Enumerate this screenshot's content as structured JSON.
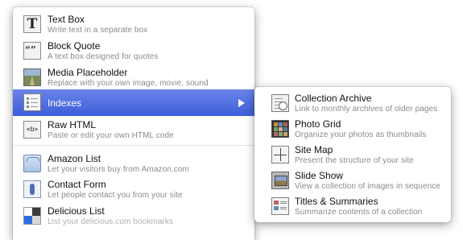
{
  "main_menu": {
    "items": [
      {
        "title": "Text Box",
        "subtitle": "Write text in a separate box",
        "icon": "text-box-icon"
      },
      {
        "title": "Block Quote",
        "subtitle": "A text box designed for quotes",
        "icon": "block-quote-icon"
      },
      {
        "title": "Media Placeholder",
        "subtitle": "Replace with your own image, movie, sound",
        "icon": "media-placeholder-icon"
      },
      {
        "title": "Indexes",
        "icon": "indexes-icon",
        "selected": true
      },
      {
        "title": "Raw HTML",
        "subtitle": "Paste or edit your own HTML code",
        "icon": "html-icon"
      },
      {
        "title": "Amazon List",
        "subtitle": "Let your visitors buy from Amazon.com",
        "icon": "amazon-list-icon"
      },
      {
        "title": "Contact Form",
        "subtitle": "Let people contact you from your site",
        "icon": "contact-form-icon"
      },
      {
        "title": "Delicious List",
        "subtitle": "List your delicious.com bookmarks",
        "icon": "delicious-list-icon"
      }
    ],
    "selected_color": "#4a6ce0"
  },
  "sub_menu": {
    "items": [
      {
        "title": "Collection Archive",
        "subtitle": "Link to monthly archives of older pages",
        "icon": "collection-archive-icon"
      },
      {
        "title": "Photo Grid",
        "subtitle": "Organize your photos as thumbnails",
        "icon": "photo-grid-icon"
      },
      {
        "title": "Site Map",
        "subtitle": "Present the structure of your site",
        "icon": "site-map-icon"
      },
      {
        "title": "Slide Show",
        "subtitle": "View a collection of images in sequence",
        "icon": "slide-show-icon"
      },
      {
        "title": "Titles & Summaries",
        "subtitle": "Summarize contents of a collection",
        "icon": "titles-summaries-icon"
      }
    ]
  }
}
